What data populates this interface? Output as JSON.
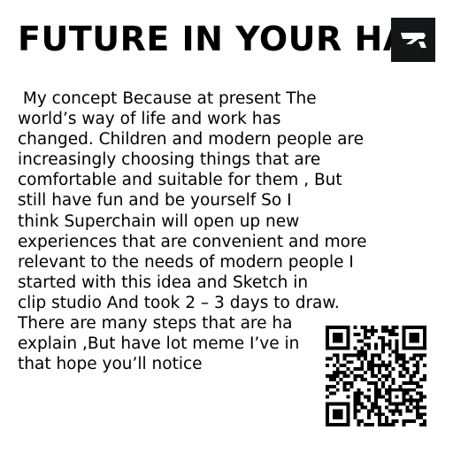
{
  "title": "FUTURE IN YOUR HAN",
  "body_lines": [
    " My concept Because at present The",
    "world’s way of life and work has",
    "changed. Children and modern people are",
    "increasingly choosing things that are",
    "comfortable and suitable for them , But",
    "still have fun and be yourself So I",
    "think Superchain will open up new",
    "experiences that are convenient and more",
    "relevant to the needs of modern people I",
    "started with this idea and Sketch in",
    "clip studio And took 2 – 3 days to draw.",
    "There are many steps that are ha",
    "explain ,But have lot meme I’ve in",
    "that hope you’ll notice"
  ],
  "logo_icon": "brand-logo-icon",
  "qr_icon": "qr-code-icon",
  "colors": {
    "text": "#000000",
    "logo_bg": "#151617",
    "logo_fg": "#ffffff"
  }
}
